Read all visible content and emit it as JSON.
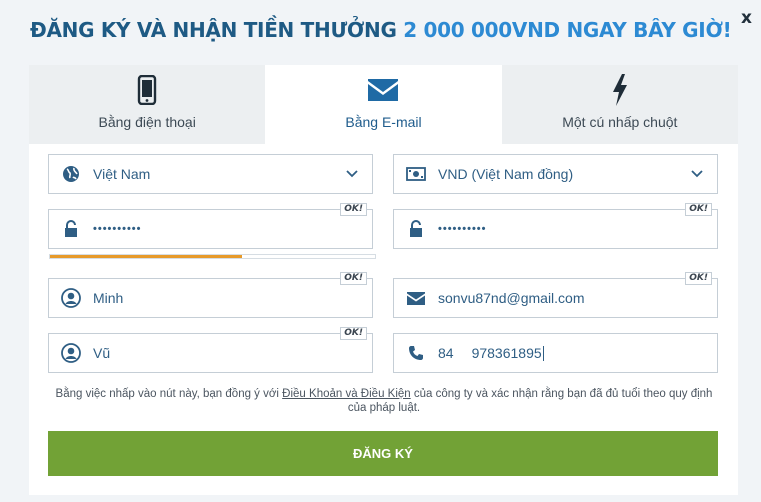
{
  "header": {
    "title_part1": "ĐĂNG KÝ VÀ NHẬN TIỀN THƯỞNG",
    "title_part2": "2 000 000VND NGAY BÂY GIỜ!",
    "close_label": "x"
  },
  "tabs": [
    {
      "label": "Bằng điện thoại",
      "icon": "phone-icon",
      "active": false
    },
    {
      "label": "Bằng E-mail",
      "icon": "envelope-icon",
      "active": true
    },
    {
      "label": "Một cú nhấp chuột",
      "icon": "lightning-icon",
      "active": false
    }
  ],
  "form": {
    "country": "Việt Nam",
    "currency": "VND (Việt Nam đồng)",
    "password": "••••••••••",
    "password_confirm": "••••••••••",
    "first_name": "Minh",
    "email": "sonvu87nd@gmail.com",
    "last_name": "Vũ",
    "phone_code": "84",
    "phone_number": "978361895",
    "ok_badge": "OK!",
    "password_strength": 0.59
  },
  "terms": {
    "before": "Bằng việc nhấp vào nút này, bạn đồng ý với ",
    "link": "Điều Khoản và Điều Kiện",
    "after": " của công ty và xác nhận rằng bạn đã đủ tuổi theo quy định của pháp luật."
  },
  "submit_label": "ĐĂNG KÝ",
  "colors": {
    "title": "#1e5a84",
    "title_highlight": "#2d8ad3",
    "accent": "#2f5e84",
    "strength": "#e79a2a",
    "submit": "#72a236"
  }
}
